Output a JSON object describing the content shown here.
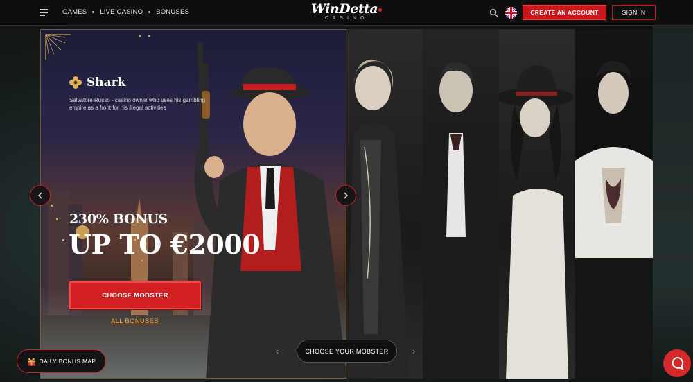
{
  "header": {
    "nav": [
      {
        "label": "GAMES"
      },
      {
        "label": "LIVE CASINO"
      },
      {
        "label": "BONUSES"
      }
    ],
    "logo": {
      "main": "WinDetta",
      "sub": "CASINO"
    },
    "create_account": "CREATE AN ACCOUNT",
    "sign_in": "SIGN IN",
    "language_flag": "uk-flag-icon"
  },
  "hero": {
    "mobster_name": "Shark",
    "mobster_desc": "Salvatore Russo - casino owner who uses his gambling empire as a front for his illegal activities",
    "bonus_percent": "230% BONUS",
    "bonus_amount": "UP TO €2000",
    "choose_button": "CHOOSE MOBSTER",
    "all_bonuses": "ALL BONUSES"
  },
  "carousel": {
    "choose_your_mobster": "CHOOSE YOUR MOBSTER",
    "prev_arrow": "‹",
    "next_arrow": "›"
  },
  "daily_bonus": "DAILY BONUS MAP",
  "colors": {
    "accent_red": "#c9161b",
    "gold": "#e8a64b",
    "header_bg": "#0e0e0e"
  }
}
